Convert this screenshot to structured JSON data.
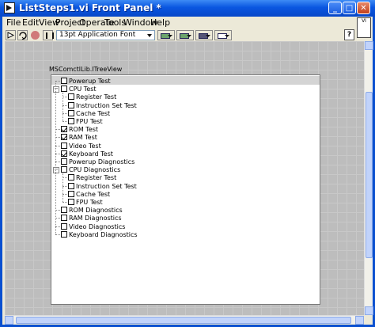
{
  "window": {
    "title": "ListSteps1.vi Front Panel *"
  },
  "menu": [
    "File",
    "Edit",
    "View",
    "Project",
    "Operate",
    "Tools",
    "Window",
    "Help"
  ],
  "toolbar": {
    "font": "13pt Application Font",
    "help": "?"
  },
  "vi_icon": {
    "text": "VI"
  },
  "control": {
    "label": "MSComctlLib.ITreeView"
  },
  "tree": [
    {
      "text": "Powerup Test",
      "level": 0,
      "checked": false,
      "selected": true
    },
    {
      "text": "CPU Test",
      "level": 0,
      "checked": false,
      "expander": "minus"
    },
    {
      "text": "Register Test",
      "level": 1,
      "checked": false
    },
    {
      "text": "Instruction Set Test",
      "level": 1,
      "checked": false
    },
    {
      "text": "Cache Test",
      "level": 1,
      "checked": false
    },
    {
      "text": "FPU Test",
      "level": 1,
      "checked": false
    },
    {
      "text": "ROM Test",
      "level": 0,
      "checked": true
    },
    {
      "text": "RAM Test",
      "level": 0,
      "checked": true
    },
    {
      "text": "Video Test",
      "level": 0,
      "checked": false
    },
    {
      "text": "Keyboard Test",
      "level": 0,
      "checked": true
    },
    {
      "text": "Powerup Diagnostics",
      "level": 0,
      "checked": false
    },
    {
      "text": "CPU Diagnostics",
      "level": 0,
      "checked": false,
      "expander": "minus"
    },
    {
      "text": "Register Test",
      "level": 1,
      "checked": false
    },
    {
      "text": "Instruction Set Test",
      "level": 1,
      "checked": false
    },
    {
      "text": "Cache Test",
      "level": 1,
      "checked": false
    },
    {
      "text": "FPU Test",
      "level": 1,
      "checked": false
    },
    {
      "text": "ROM Diagnostics",
      "level": 0,
      "checked": false
    },
    {
      "text": "RAM Diagnostics",
      "level": 0,
      "checked": false
    },
    {
      "text": "Video Diagnostics",
      "level": 0,
      "checked": false
    },
    {
      "text": "Keyboard Diagnostics",
      "level": 0,
      "checked": false
    }
  ]
}
